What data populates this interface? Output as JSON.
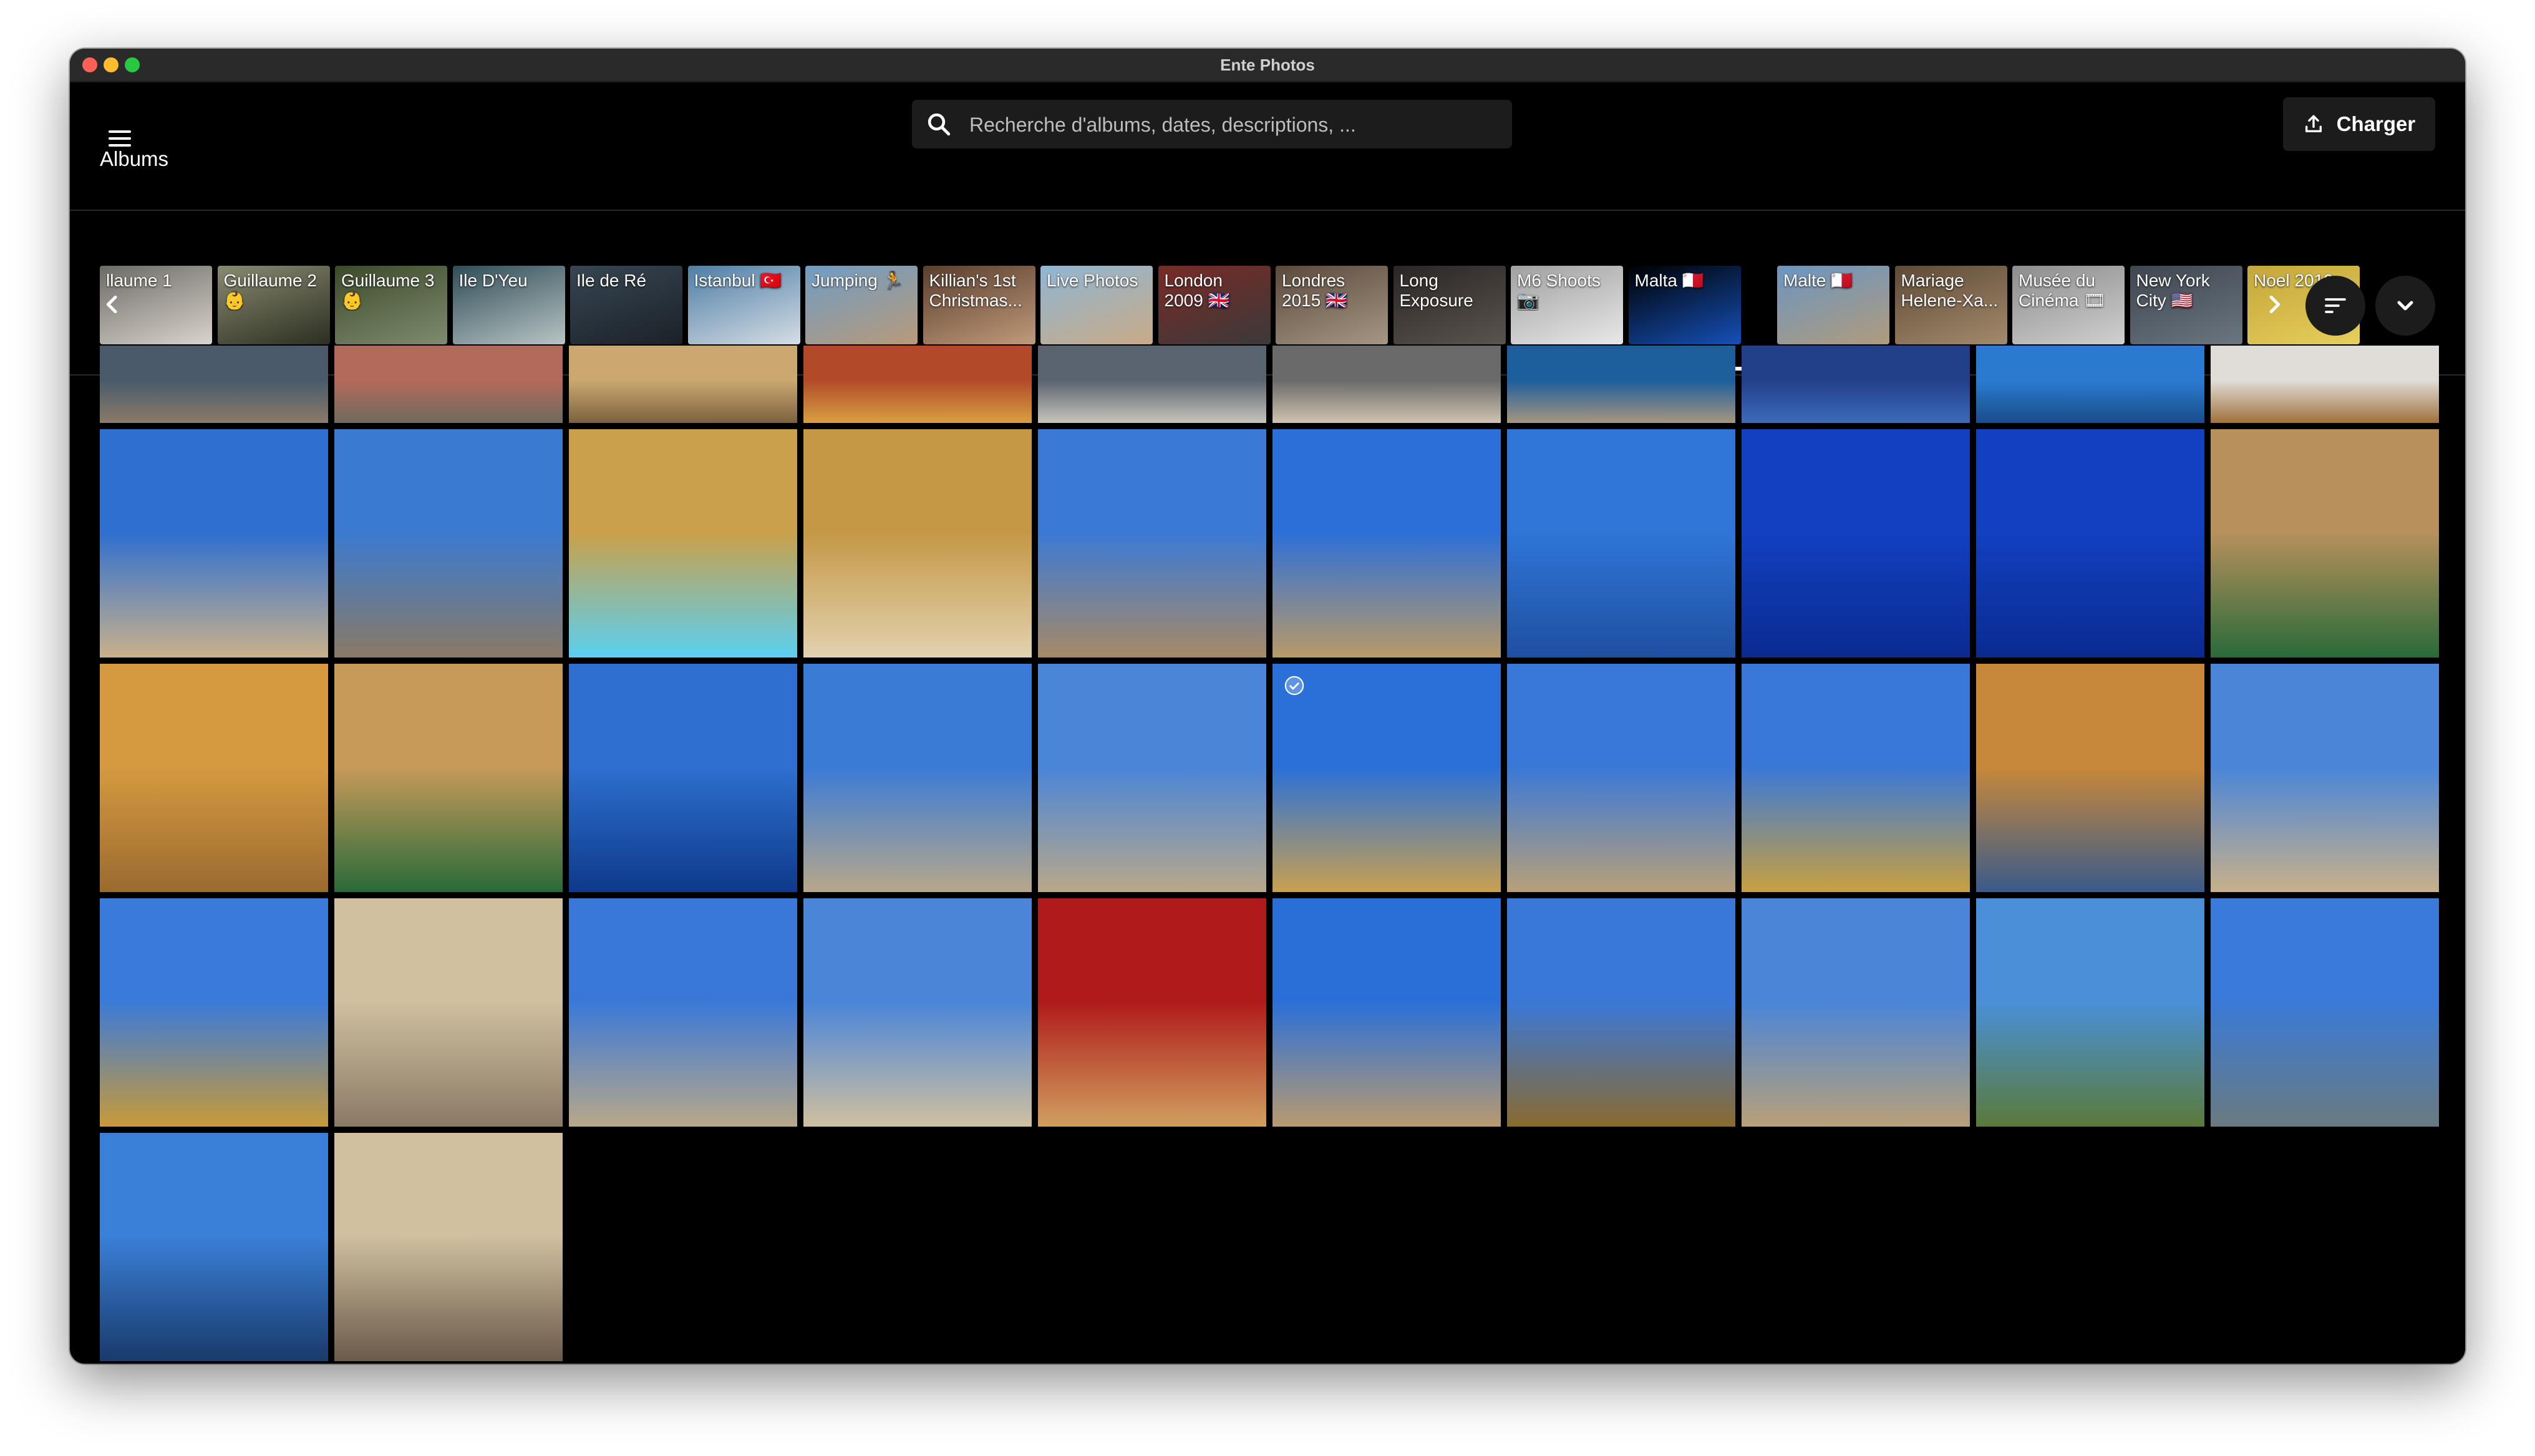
{
  "window": {
    "title": "Ente Photos"
  },
  "search": {
    "placeholder": "Recherche d'albums, dates, descriptions, ..."
  },
  "toolbar": {
    "upload_label": "Charger"
  },
  "albums": {
    "heading": "Albums",
    "items": [
      {
        "label": "llaume 1",
        "colors": [
          "#6d6a66",
          "#d9d4cc"
        ]
      },
      {
        "label": "Guillaume 2\n👶",
        "colors": [
          "#8a8a70",
          "#2b2f22"
        ]
      },
      {
        "label": "Guillaume 3\n👶",
        "colors": [
          "#3c4a2a",
          "#7f8b6f"
        ]
      },
      {
        "label": "Ile D'Yeu",
        "colors": [
          "#2f4d57",
          "#b9c4c4"
        ]
      },
      {
        "label": "Ile de Ré",
        "colors": [
          "#374652",
          "#1b2128"
        ]
      },
      {
        "label": "Istanbul 🇹🇷",
        "colors": [
          "#4e7ea6",
          "#d6dde4"
        ]
      },
      {
        "label": "Jumping 🏃",
        "colors": [
          "#6f9cc4",
          "#b89a7a"
        ]
      },
      {
        "label": "Killian's 1st\nChristmas...",
        "colors": [
          "#5a3e2e",
          "#c09a7a"
        ]
      },
      {
        "label": "Live Photos",
        "colors": [
          "#8fb6d4",
          "#c9aa86"
        ]
      },
      {
        "label": "London\n2009 🇬🇧",
        "colors": [
          "#7a2a26",
          "#3a3a3a"
        ]
      },
      {
        "label": "Londres\n2015 🇬🇧",
        "colors": [
          "#5b4a3c",
          "#a69684"
        ]
      },
      {
        "label": "Long\nExposure",
        "colors": [
          "#2a2624",
          "#5a544e"
        ]
      },
      {
        "label": "M6 Shoots\n📷",
        "colors": [
          "#a0a0a0",
          "#e8e8e8"
        ]
      },
      {
        "label": "Malta 🇲🇹",
        "colors": [
          "#000000",
          "#1550b8"
        ]
      },
      {
        "label": "Malte 🇲🇹",
        "colors": [
          "#6a95c2",
          "#b19b7c"
        ]
      },
      {
        "label": "Mariage\nHelene-Xa...",
        "colors": [
          "#5e4a36",
          "#a38a6c"
        ]
      },
      {
        "label": "Musée du\nCinéma 🎞",
        "colors": [
          "#8c8c8c",
          "#d0d0d0"
        ]
      },
      {
        "label": "New York\nCity 🇺🇸",
        "colors": [
          "#3e4650",
          "#6c7680"
        ]
      },
      {
        "label": "Noel 2019",
        "colors": [
          "#c4a63a",
          "#e6cf5c"
        ]
      }
    ]
  },
  "photos": {
    "row0": [
      [
        "#4a5a6a",
        "#8a7a6a"
      ],
      [
        "#b36a5a",
        "#6f6a5e"
      ],
      [
        "#caa870",
        "#7b6240"
      ],
      [
        "#b24a2a",
        "#d8a040"
      ],
      [
        "#5a6470",
        "#c8c4bc"
      ],
      [
        "#6a6a6a",
        "#cfc4b0"
      ],
      [
        "#1d5e9c",
        "#a69680"
      ],
      [
        "#223f8a",
        "#3d6ab8"
      ],
      [
        "#2a7bd0",
        "#1a4d8a"
      ],
      [
        "#e0ddd8",
        "#a0703c"
      ]
    ],
    "row1": [
      [
        "#2e6fcf",
        "#c9b18b"
      ],
      [
        "#3a7ad0",
        "#8a7a66"
      ],
      [
        "#caa04a",
        "#5ad0f0"
      ],
      [
        "#c49845",
        "#e2d2b0"
      ],
      [
        "#3a7ad6",
        "#a68a66"
      ],
      [
        "#2d6fd8",
        "#b89a68"
      ],
      [
        "#2f76d8",
        "#1f4fa0"
      ],
      [
        "#1240c0",
        "#0a2a90"
      ],
      [
        "#1240c0",
        "#0a2a90"
      ],
      [
        "#b8905c",
        "#2a6a3a"
      ]
    ],
    "row2": [
      [
        "#d59a40",
        "#9a6a30"
      ],
      [
        "#c89a5a",
        "#2a6a3a"
      ],
      [
        "#2e6fcf",
        "#0e3a8a"
      ],
      [
        "#3a7bd6",
        "#b7a78a"
      ],
      [
        "#4a85d8",
        "#b9a889"
      ],
      [
        "#2a70d8",
        "#c8a050"
      ],
      [
        "#3a78d8",
        "#b8a078"
      ],
      [
        "#3a78d8",
        "#c8a040"
      ],
      [
        "#c8883a",
        "#3a5a8a"
      ],
      [
        "#4a85d8",
        "#c8b08a"
      ]
    ],
    "row3": [
      [
        "#3a7ad8",
        "#c89a3a"
      ],
      [
        "#d0c0a0",
        "#8a7a66"
      ],
      [
        "#3a78d8",
        "#b8a888"
      ],
      [
        "#4a85d8",
        "#d0c0a0"
      ],
      [
        "#b01a1a",
        "#d0a060"
      ],
      [
        "#2a6fd8",
        "#b89a70"
      ],
      [
        "#3a78d8",
        "#8a6a30"
      ],
      [
        "#4a85d8",
        "#b8a078"
      ],
      [
        "#4a90d8",
        "#5a7a3a"
      ],
      [
        "#3a7ad8",
        "#6a7a80"
      ]
    ],
    "row4": [
      [
        "#3a80d8",
        "#1a3a6a"
      ],
      [
        "#d0c0a0",
        "#6a5a4a"
      ]
    ]
  }
}
